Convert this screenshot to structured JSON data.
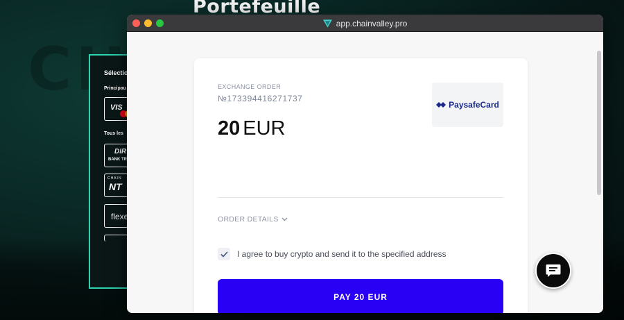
{
  "background": {
    "title": "Portefeuille",
    "panel": {
      "heading": "Sélection",
      "subheading_main": "Principau",
      "subheading_all": "Tous les",
      "cards": {
        "visa": "VIS",
        "direct_top": "DIR",
        "direct_bottom": "BANK TR",
        "chain_top": "CHAIN",
        "chain_main": "NT",
        "flex": "flexe"
      }
    }
  },
  "browser": {
    "url": "app.chainvalley.pro",
    "favicon": "triangle-logo-icon"
  },
  "order": {
    "label": "EXCHANGE ORDER",
    "number": "№173394416271737",
    "amount": "20",
    "currency": "EUR",
    "payment_method": "PaysafeCard",
    "details_toggle": "ORDER DETAILS",
    "agree_text": "I agree to buy crypto and send it to the specified address",
    "agree_checked": true,
    "pay_button": "PAY 20 EUR"
  },
  "colors": {
    "accent": "#2a00f5",
    "panel_border": "#2fd3b0",
    "paysafe_blue": "#1b2a8a"
  },
  "chat": {
    "icon": "chat-bubble-icon"
  }
}
